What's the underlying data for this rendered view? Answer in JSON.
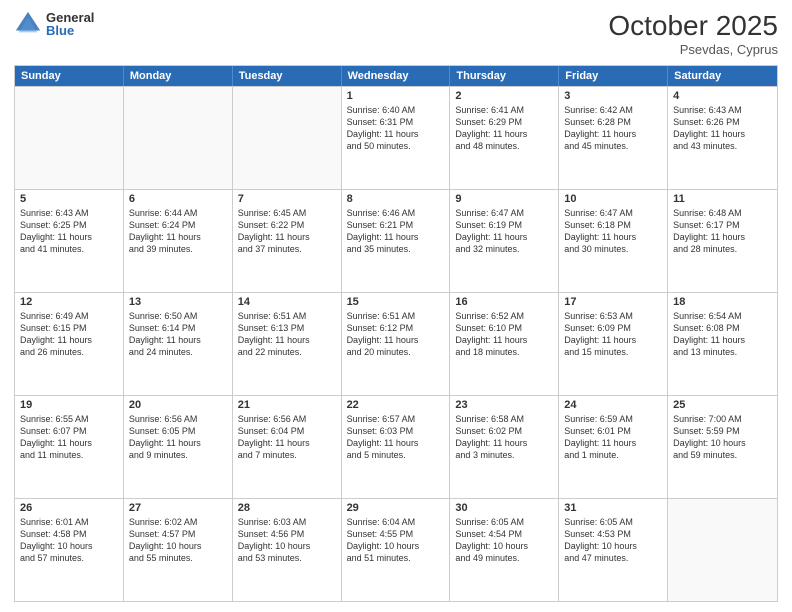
{
  "header": {
    "logo_general": "General",
    "logo_blue": "Blue",
    "month": "October 2025",
    "location": "Psevdas, Cyprus"
  },
  "weekdays": [
    "Sunday",
    "Monday",
    "Tuesday",
    "Wednesday",
    "Thursday",
    "Friday",
    "Saturday"
  ],
  "weeks": [
    [
      {
        "day": "",
        "text": ""
      },
      {
        "day": "",
        "text": ""
      },
      {
        "day": "",
        "text": ""
      },
      {
        "day": "1",
        "text": "Sunrise: 6:40 AM\nSunset: 6:31 PM\nDaylight: 11 hours\nand 50 minutes."
      },
      {
        "day": "2",
        "text": "Sunrise: 6:41 AM\nSunset: 6:29 PM\nDaylight: 11 hours\nand 48 minutes."
      },
      {
        "day": "3",
        "text": "Sunrise: 6:42 AM\nSunset: 6:28 PM\nDaylight: 11 hours\nand 45 minutes."
      },
      {
        "day": "4",
        "text": "Sunrise: 6:43 AM\nSunset: 6:26 PM\nDaylight: 11 hours\nand 43 minutes."
      }
    ],
    [
      {
        "day": "5",
        "text": "Sunrise: 6:43 AM\nSunset: 6:25 PM\nDaylight: 11 hours\nand 41 minutes."
      },
      {
        "day": "6",
        "text": "Sunrise: 6:44 AM\nSunset: 6:24 PM\nDaylight: 11 hours\nand 39 minutes."
      },
      {
        "day": "7",
        "text": "Sunrise: 6:45 AM\nSunset: 6:22 PM\nDaylight: 11 hours\nand 37 minutes."
      },
      {
        "day": "8",
        "text": "Sunrise: 6:46 AM\nSunset: 6:21 PM\nDaylight: 11 hours\nand 35 minutes."
      },
      {
        "day": "9",
        "text": "Sunrise: 6:47 AM\nSunset: 6:19 PM\nDaylight: 11 hours\nand 32 minutes."
      },
      {
        "day": "10",
        "text": "Sunrise: 6:47 AM\nSunset: 6:18 PM\nDaylight: 11 hours\nand 30 minutes."
      },
      {
        "day": "11",
        "text": "Sunrise: 6:48 AM\nSunset: 6:17 PM\nDaylight: 11 hours\nand 28 minutes."
      }
    ],
    [
      {
        "day": "12",
        "text": "Sunrise: 6:49 AM\nSunset: 6:15 PM\nDaylight: 11 hours\nand 26 minutes."
      },
      {
        "day": "13",
        "text": "Sunrise: 6:50 AM\nSunset: 6:14 PM\nDaylight: 11 hours\nand 24 minutes."
      },
      {
        "day": "14",
        "text": "Sunrise: 6:51 AM\nSunset: 6:13 PM\nDaylight: 11 hours\nand 22 minutes."
      },
      {
        "day": "15",
        "text": "Sunrise: 6:51 AM\nSunset: 6:12 PM\nDaylight: 11 hours\nand 20 minutes."
      },
      {
        "day": "16",
        "text": "Sunrise: 6:52 AM\nSunset: 6:10 PM\nDaylight: 11 hours\nand 18 minutes."
      },
      {
        "day": "17",
        "text": "Sunrise: 6:53 AM\nSunset: 6:09 PM\nDaylight: 11 hours\nand 15 minutes."
      },
      {
        "day": "18",
        "text": "Sunrise: 6:54 AM\nSunset: 6:08 PM\nDaylight: 11 hours\nand 13 minutes."
      }
    ],
    [
      {
        "day": "19",
        "text": "Sunrise: 6:55 AM\nSunset: 6:07 PM\nDaylight: 11 hours\nand 11 minutes."
      },
      {
        "day": "20",
        "text": "Sunrise: 6:56 AM\nSunset: 6:05 PM\nDaylight: 11 hours\nand 9 minutes."
      },
      {
        "day": "21",
        "text": "Sunrise: 6:56 AM\nSunset: 6:04 PM\nDaylight: 11 hours\nand 7 minutes."
      },
      {
        "day": "22",
        "text": "Sunrise: 6:57 AM\nSunset: 6:03 PM\nDaylight: 11 hours\nand 5 minutes."
      },
      {
        "day": "23",
        "text": "Sunrise: 6:58 AM\nSunset: 6:02 PM\nDaylight: 11 hours\nand 3 minutes."
      },
      {
        "day": "24",
        "text": "Sunrise: 6:59 AM\nSunset: 6:01 PM\nDaylight: 11 hours\nand 1 minute."
      },
      {
        "day": "25",
        "text": "Sunrise: 7:00 AM\nSunset: 5:59 PM\nDaylight: 10 hours\nand 59 minutes."
      }
    ],
    [
      {
        "day": "26",
        "text": "Sunrise: 6:01 AM\nSunset: 4:58 PM\nDaylight: 10 hours\nand 57 minutes."
      },
      {
        "day": "27",
        "text": "Sunrise: 6:02 AM\nSunset: 4:57 PM\nDaylight: 10 hours\nand 55 minutes."
      },
      {
        "day": "28",
        "text": "Sunrise: 6:03 AM\nSunset: 4:56 PM\nDaylight: 10 hours\nand 53 minutes."
      },
      {
        "day": "29",
        "text": "Sunrise: 6:04 AM\nSunset: 4:55 PM\nDaylight: 10 hours\nand 51 minutes."
      },
      {
        "day": "30",
        "text": "Sunrise: 6:05 AM\nSunset: 4:54 PM\nDaylight: 10 hours\nand 49 minutes."
      },
      {
        "day": "31",
        "text": "Sunrise: 6:05 AM\nSunset: 4:53 PM\nDaylight: 10 hours\nand 47 minutes."
      },
      {
        "day": "",
        "text": ""
      }
    ]
  ]
}
